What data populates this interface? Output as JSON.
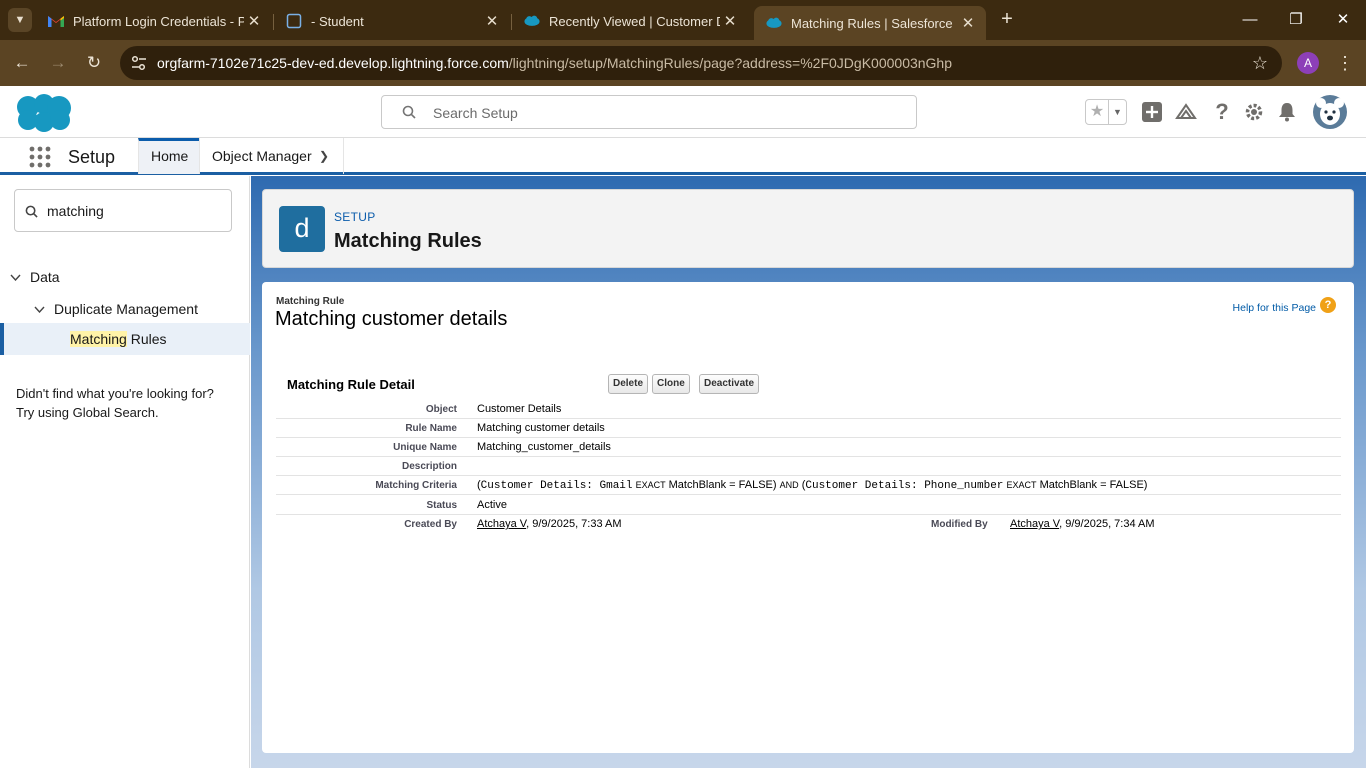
{
  "browser": {
    "tabs": [
      {
        "title": "Platform Login Credentials - Pro",
        "icon": "gmail-icon"
      },
      {
        "title": "- Student",
        "icon": "trailhead-icon"
      },
      {
        "title": "Recently Viewed | Customer Det",
        "icon": "salesforce-cloud-icon"
      },
      {
        "title": "Matching Rules | Salesforce",
        "icon": "salesforce-cloud-icon",
        "active": true
      }
    ],
    "url_host": "orgfarm-7102e71c25-dev-ed.develop.lightning.force.com",
    "url_path": "/lightning/setup/MatchingRules/page?address=%2F0JDgK000003nGhp",
    "profile_initial": "A"
  },
  "header": {
    "search_placeholder": "Search Setup"
  },
  "nav": {
    "app_name": "Setup",
    "tabs": [
      {
        "label": "Home"
      },
      {
        "label": "Object Manager"
      }
    ]
  },
  "sidebar": {
    "quick_find_value": "matching",
    "tree": {
      "level1": "Data",
      "level2": "Duplicate Management",
      "level3_highlight": "Matching",
      "level3_rest": " Rules"
    },
    "not_found_line1": "Didn't find what you're looking for?",
    "not_found_line2": "Try using Global Search."
  },
  "page_header": {
    "icon_letter": "d",
    "eyebrow": "SETUP",
    "title": "Matching Rules"
  },
  "detail": {
    "entity_type": "Matching Rule",
    "entity_name": "Matching customer details",
    "help_link": "Help for this Page",
    "section_title": "Matching Rule Detail",
    "buttons": {
      "delete": "Delete",
      "clone": "Clone",
      "deactivate": "Deactivate"
    },
    "fields": {
      "object_label": "Object",
      "object_value": "Customer Details",
      "rule_name_label": "Rule Name",
      "rule_name_value": "Matching customer details",
      "unique_name_label": "Unique Name",
      "unique_name_value": "Matching_customer_details",
      "description_label": "Description",
      "description_value": "",
      "criteria_label": "Matching Criteria",
      "criteria": {
        "open1": "(",
        "field1": "Customer Details: Gmail",
        "op1": "EXACT",
        "blank1": "MatchBlank = FALSE)",
        "and": "AND",
        "open2": "(",
        "field2": "Customer Details: Phone_number",
        "op2": "EXACT",
        "blank2": "MatchBlank = FALSE)"
      },
      "status_label": "Status",
      "status_value": "Active",
      "created_by_label": "Created By",
      "created_by_user": "Atchaya V",
      "created_by_date": ", 9/9/2025, 7:33 AM",
      "modified_by_label": "Modified By",
      "modified_by_user": "Atchaya V",
      "modified_by_date": ", 9/9/2025, 7:34 AM"
    }
  },
  "colors": {
    "chrome_dark": "#3c2a10",
    "chrome_toolbar": "#5b4423",
    "salesforce_blue": "#0b5cab",
    "brand_band": "#1b5fa3",
    "setup_icon_bg": "#1f6e9f"
  }
}
